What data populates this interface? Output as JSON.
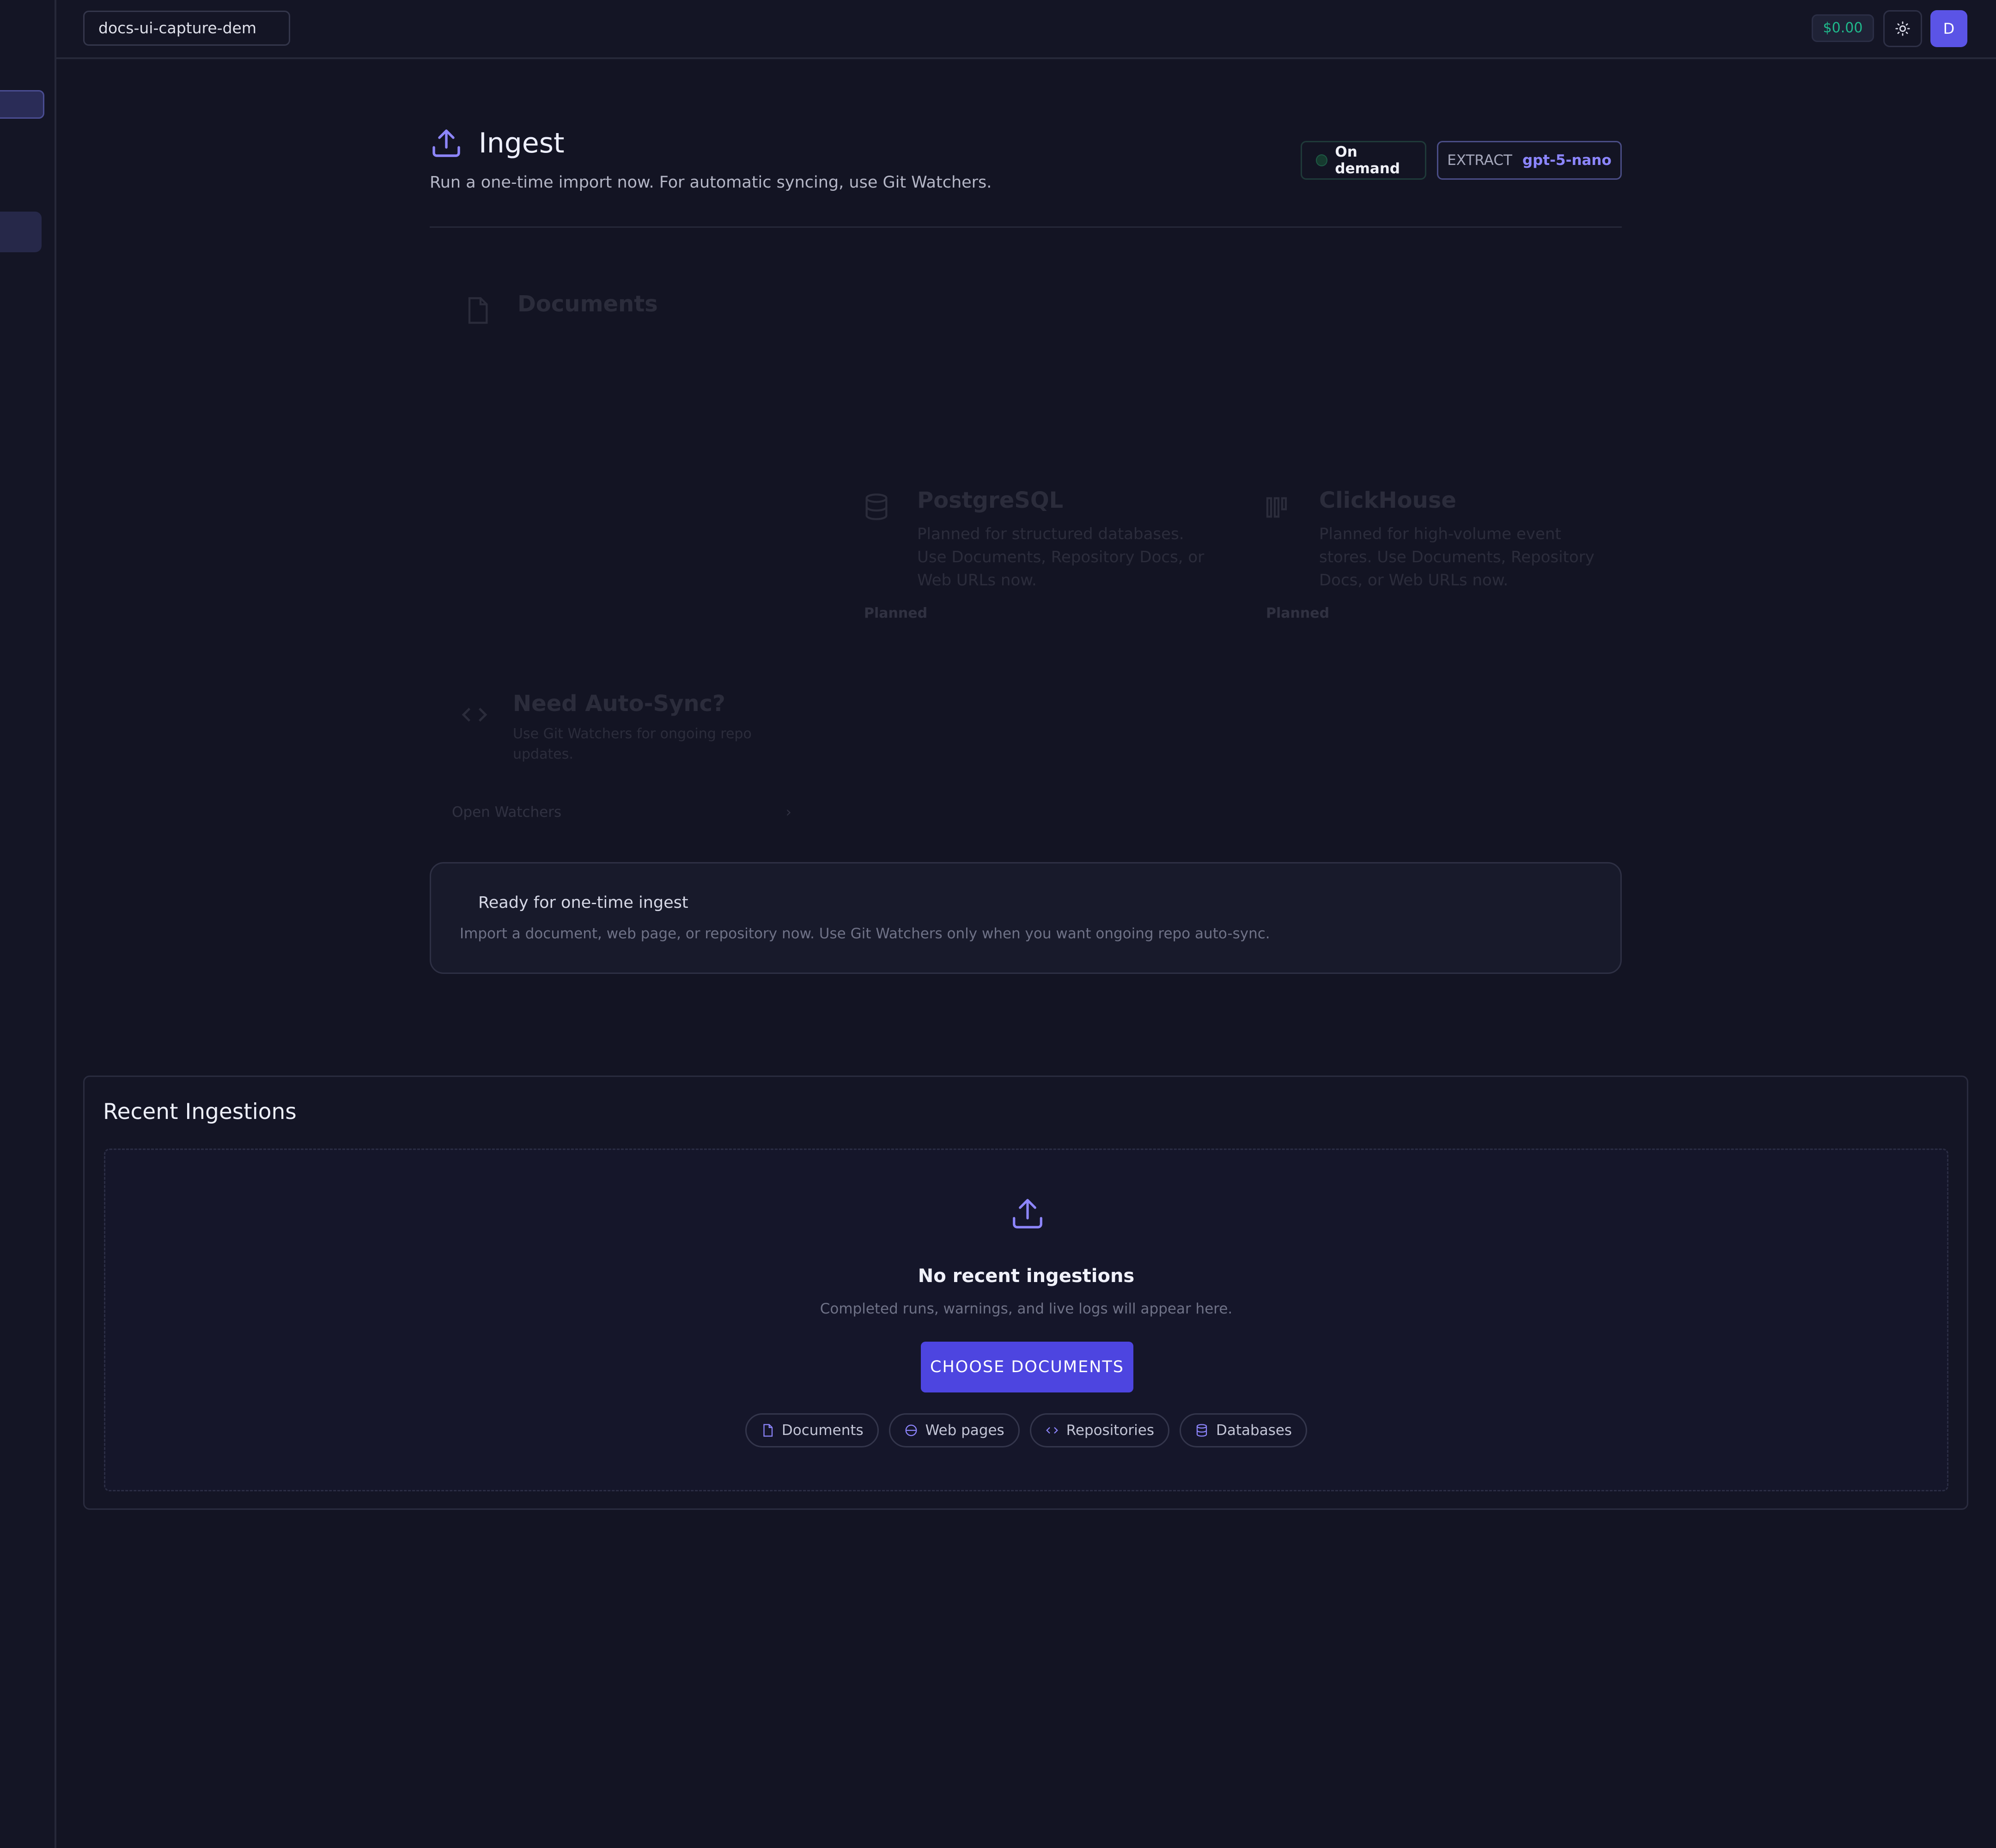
{
  "topbar": {
    "project_name": "docs-ui-capture-dem",
    "cost": "$0.00",
    "avatar_initial": "D"
  },
  "header": {
    "title": "Ingest",
    "subtitle": "Run a one-time import now. For automatic syncing, use Git Watchers.",
    "mode_label": "On demand",
    "extract_label": "EXTRACT",
    "extract_model": "gpt-5-nano"
  },
  "sources": {
    "documents_title": "Documents",
    "postgres": {
      "title": "PostgreSQL",
      "desc": "Planned for structured databases. Use Documents, Repository Docs, or Web URLs now.",
      "status": "Planned"
    },
    "clickhouse": {
      "title": "ClickHouse",
      "desc": "Planned for high-volume event stores. Use Documents, Repository Docs, or Web URLs now.",
      "status": "Planned"
    },
    "autosync": {
      "title": "Need Auto-Sync?",
      "desc": "Use Git Watchers for ongoing repo updates.",
      "link": "Open Watchers"
    }
  },
  "ready": {
    "title": "Ready for one-time ingest",
    "desc": "Import a document, web page, or repository now. Use Git Watchers only when you want ongoing repo auto-sync."
  },
  "recent": {
    "title": "Recent Ingestions",
    "empty_title": "No recent ingestions",
    "empty_desc": "Completed runs, warnings, and live logs will appear here.",
    "cta": "CHOOSE DOCUMENTS",
    "chips": [
      "Documents",
      "Web pages",
      "Repositories",
      "Databases"
    ]
  },
  "colors": {
    "accent": "#5b54e6",
    "cost_green": "#1fb98c",
    "background": "#131423"
  }
}
